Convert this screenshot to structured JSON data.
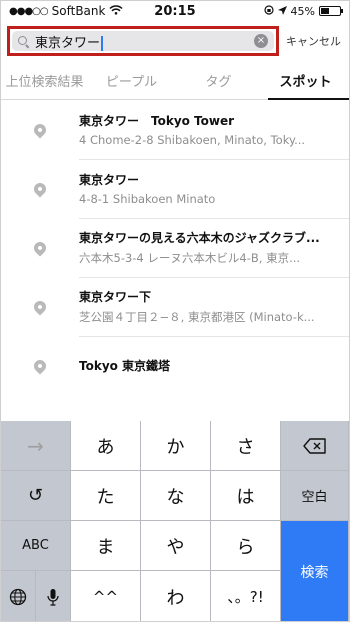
{
  "status": {
    "carrier": "SoftBank",
    "signal": "●●●○○",
    "time": "20:15",
    "battery_text": "45%",
    "battery_level": 0.45
  },
  "search": {
    "value": "東京タワー",
    "cancel_label": "キャンセル"
  },
  "tabs": [
    {
      "label": "上位検索結果",
      "active": false
    },
    {
      "label": "ピープル",
      "active": false
    },
    {
      "label": "タグ",
      "active": false
    },
    {
      "label": "スポット",
      "active": true
    }
  ],
  "results": [
    {
      "title": "東京タワー　Tokyo Tower",
      "subtitle": "4 Chome-2-8 Shibakoen, Minato, Toky..."
    },
    {
      "title": "東京タワー",
      "subtitle": "4-8-1 Shibakoen Minato"
    },
    {
      "title": "東京タワーの見える六本木のジャズクラブ...",
      "subtitle": "六本木5-3-4 レーヌ六本木ビル4-B, 東京..."
    },
    {
      "title": "東京タワー下",
      "subtitle": "芝公園４丁目２−８, 東京都港区 (Minato-k..."
    },
    {
      "title": "Tokyo 東京鐵塔",
      "subtitle": ""
    }
  ],
  "keyboard": {
    "row1": [
      "→",
      "あ",
      "か",
      "さ",
      "⌫"
    ],
    "row2": [
      "↺",
      "た",
      "な",
      "は",
      "空白"
    ],
    "row3": [
      "ABC",
      "ま",
      "や",
      "ら"
    ],
    "row4": [
      "globe",
      "mic",
      "^^",
      "わ",
      "、。?!"
    ],
    "search_label": "検索"
  }
}
